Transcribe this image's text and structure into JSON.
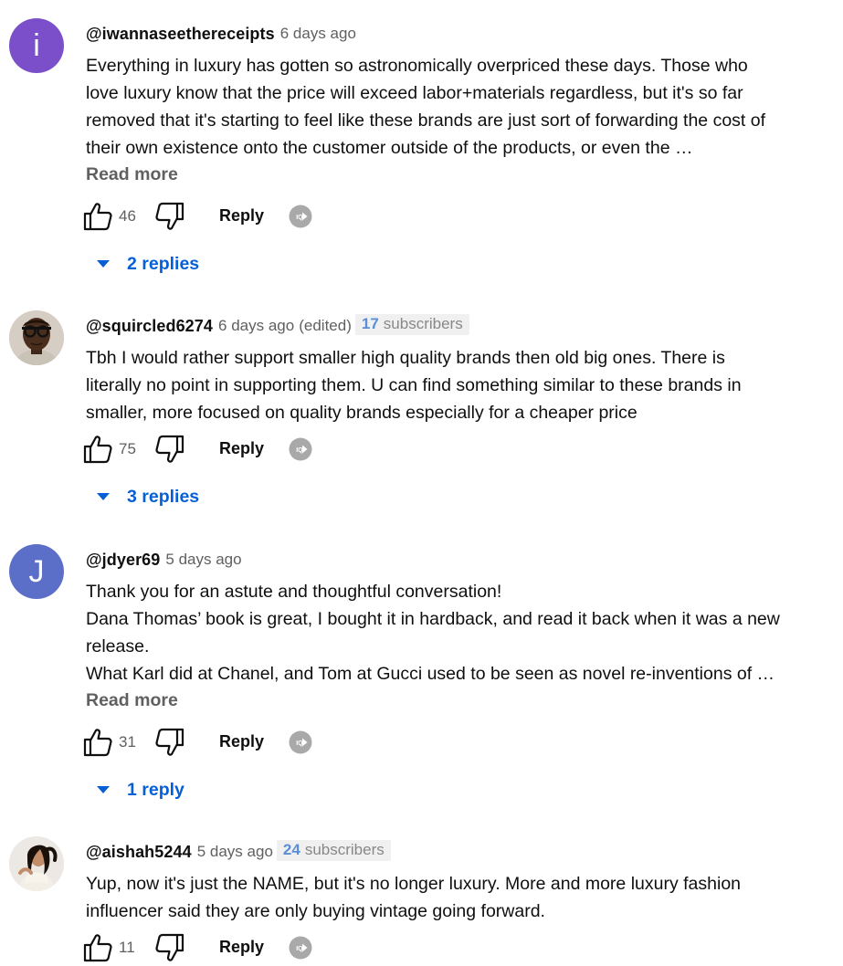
{
  "colors": {
    "accent_blue": "#065fd4",
    "secondary_text": "#606060",
    "avatar_i": "#7b4fc9",
    "avatar_j": "#5b6fc9",
    "subscriber_count_blue": "#5a8fd8"
  },
  "comments": [
    {
      "avatar": {
        "type": "letter",
        "letter": "i"
      },
      "author": "@iwannaseethereceipts",
      "time": "6 days ago",
      "lines": [
        "Everything in luxury has gotten so astronomically overpriced these days. Those who",
        "love luxury know that the price will exceed labor+materials regardless, but it's so far",
        "removed that it's starting to feel like these brands are just sort of forwarding the cost of",
        "their own existence onto the customer outside of the products, or even the …"
      ],
      "read_more": "Read more",
      "likes": "46",
      "reply_label": "Reply",
      "replies": "2 replies"
    },
    {
      "avatar": {
        "type": "photo",
        "icon": "avatar-glasses-photo"
      },
      "author": "@squircled6274",
      "time": "6 days ago",
      "edited": "(edited)",
      "subscribers": {
        "count": "17",
        "label": "subscribers"
      },
      "lines": [
        "Tbh I would rather support smaller high quality brands then old big ones. There is",
        "literally no point in supporting them. U can find something similar to these brands in",
        "smaller, more focused on quality brands especially for a cheaper price"
      ],
      "likes": "75",
      "reply_label": "Reply",
      "replies": "3 replies"
    },
    {
      "avatar": {
        "type": "letter",
        "letter": "J"
      },
      "author": "@jdyer69",
      "time": "5 days ago",
      "lines": [
        "Thank you for an astute and thoughtful conversation!",
        "Dana Thomas’ book is great, I bought it in hardback, and read it back when it was a new",
        "release.",
        "What Karl did at Chanel, and Tom at Gucci used to be seen as novel re-inventions of …"
      ],
      "read_more": "Read more",
      "likes": "31",
      "reply_label": "Reply",
      "replies": "1 reply"
    },
    {
      "avatar": {
        "type": "photo",
        "icon": "avatar-woman-photo"
      },
      "author": "@aishah5244",
      "time": "5 days ago",
      "subscribers": {
        "count": "24",
        "label": "subscribers"
      },
      "lines": [
        "Yup, now it's just the NAME, but it's no longer luxury. More and more luxury fashion",
        "influencer said they are only buying vintage going forward."
      ],
      "likes": "11",
      "reply_label": "Reply"
    }
  ]
}
